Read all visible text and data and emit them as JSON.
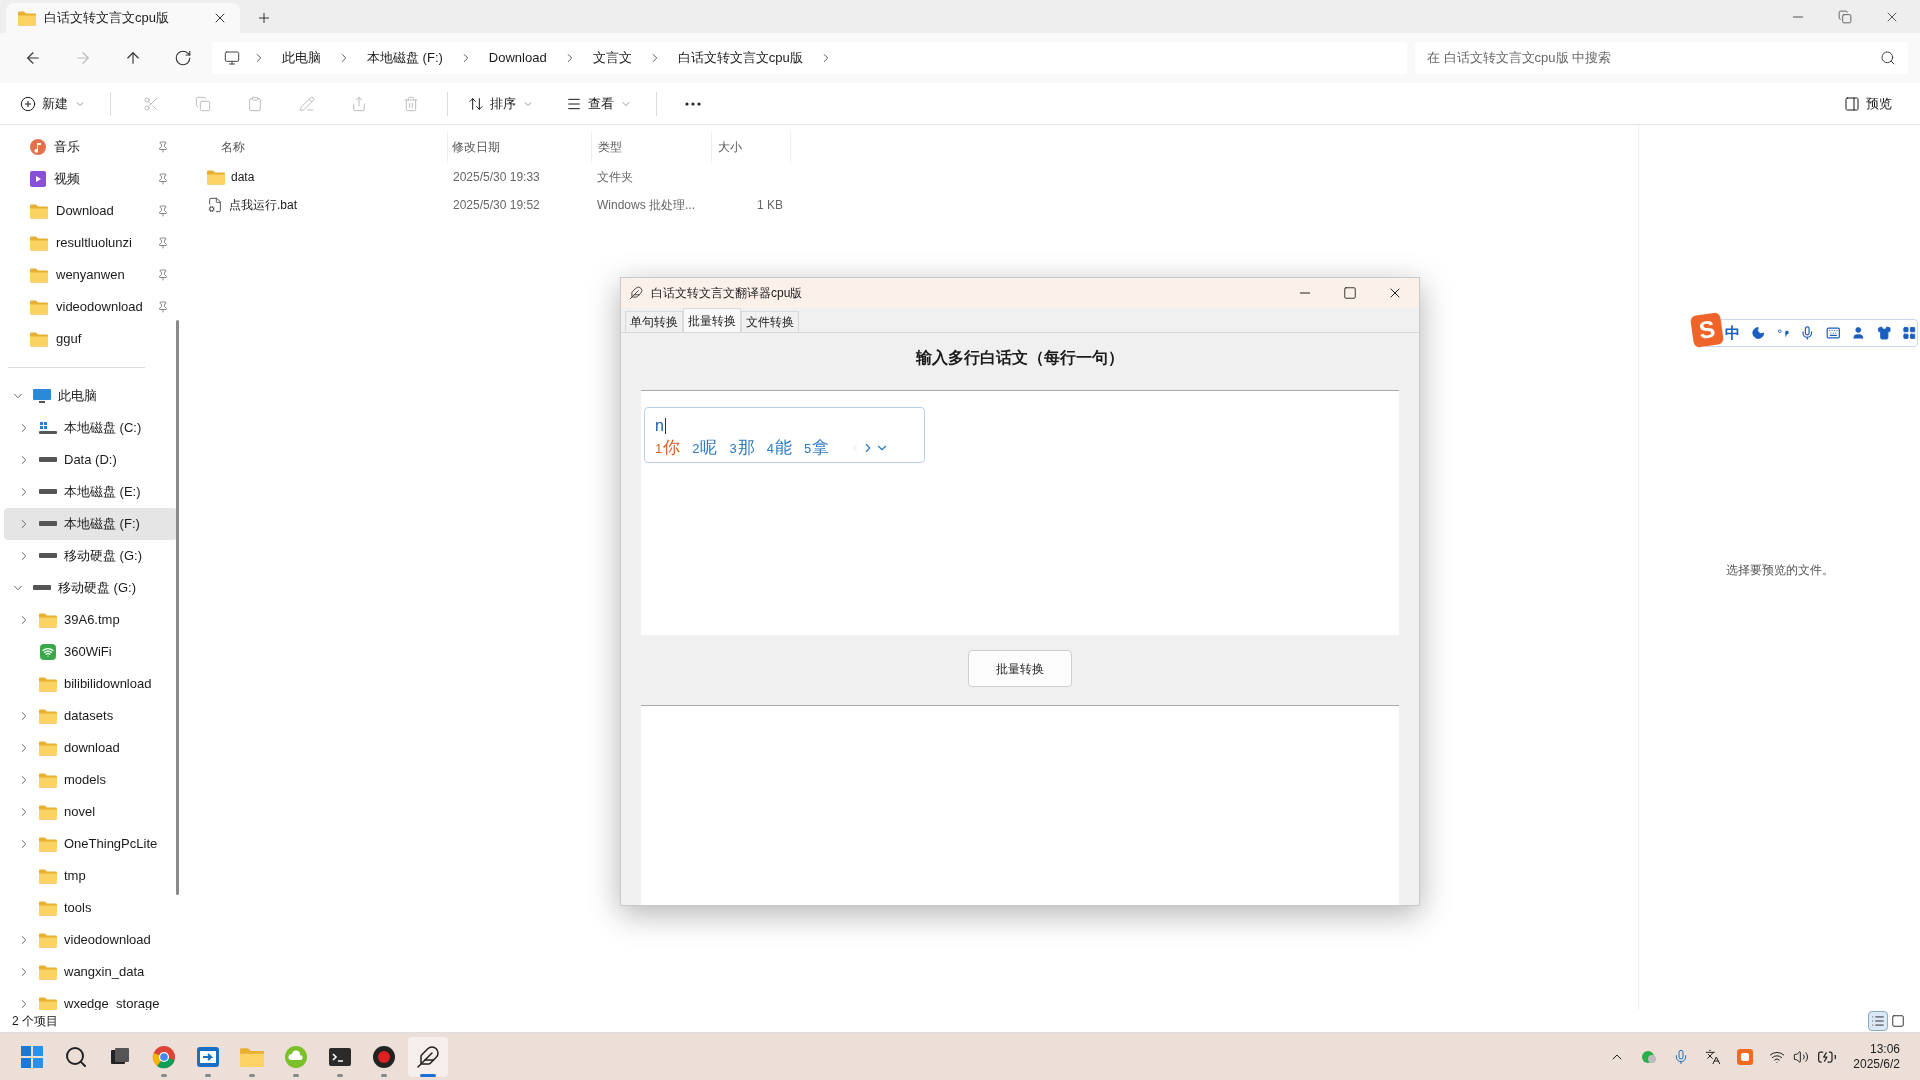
{
  "explorer": {
    "tab_title": "白话文转文言文cpu版"
  },
  "breadcrumb": [
    "此电脑",
    "本地磁盘 (F:)",
    "Download",
    "文言文",
    "白话文转文言文cpu版"
  ],
  "search": {
    "placeholder": "在 白话文转文言文cpu版 中搜索"
  },
  "toolbar": {
    "new": "新建",
    "actions": [
      {
        "kind": "cut",
        "disabled": true
      },
      {
        "kind": "copy",
        "disabled": true
      },
      {
        "kind": "paste",
        "disabled": true
      },
      {
        "kind": "rename",
        "disabled": true
      },
      {
        "kind": "share",
        "disabled": true
      },
      {
        "kind": "delete",
        "disabled": true
      }
    ],
    "sort": "排序",
    "view": "查看",
    "preview": "预览"
  },
  "quick_access": [
    {
      "name": "音乐",
      "kind": "music",
      "pinned": true
    },
    {
      "name": "视频",
      "kind": "video",
      "pinned": true
    },
    {
      "name": "Download",
      "kind": "folder",
      "pinned": true
    },
    {
      "name": "resultluolunzi",
      "kind": "folder",
      "pinned": true
    },
    {
      "name": "wenyanwen",
      "kind": "folder",
      "pinned": true
    },
    {
      "name": "videodownload",
      "kind": "folder",
      "pinned": true
    },
    {
      "name": "gguf",
      "kind": "folder",
      "pinned": false
    }
  ],
  "tree": [
    {
      "name": "此电脑",
      "kind": "pc",
      "expandable": true,
      "expanded": true,
      "selected": false,
      "children": [
        {
          "name": "本地磁盘 (C:)",
          "kind": "os_drive",
          "expandable": true,
          "expanded": false,
          "selected": false
        },
        {
          "name": "Data (D:)",
          "kind": "drive",
          "expandable": true,
          "expanded": false,
          "selected": false
        },
        {
          "name": "本地磁盘 (E:)",
          "kind": "drive",
          "expandable": true,
          "expanded": false,
          "selected": false
        },
        {
          "name": "本地磁盘 (F:)",
          "kind": "drive",
          "expandable": true,
          "expanded": false,
          "selected": true
        },
        {
          "name": "移动硬盘 (G:)",
          "kind": "drive",
          "expandable": true,
          "expanded": false,
          "selected": false
        }
      ]
    },
    {
      "name": "移动硬盘 (G:)",
      "kind": "drive",
      "expandable": true,
      "expanded": true,
      "selected": false,
      "children": [
        {
          "name": "39A6.tmp",
          "kind": "folder",
          "expandable": true,
          "expanded": false,
          "selected": false
        },
        {
          "name": "360WiFi",
          "kind": "wifi_app",
          "expandable": false,
          "expanded": false,
          "selected": false
        },
        {
          "name": "bilibilidownload",
          "kind": "folder",
          "expandable": false,
          "expanded": false,
          "selected": false
        },
        {
          "name": "datasets",
          "kind": "folder",
          "expandable": true,
          "expanded": false,
          "selected": false
        },
        {
          "name": "download",
          "kind": "folder",
          "expandable": true,
          "expanded": false,
          "selected": false
        },
        {
          "name": "models",
          "kind": "folder",
          "expandable": true,
          "expanded": false,
          "selected": false
        },
        {
          "name": "novel",
          "kind": "folder",
          "expandable": true,
          "expanded": false,
          "selected": false
        },
        {
          "name": "OneThingPcLite",
          "kind": "folder",
          "expandable": true,
          "expanded": false,
          "selected": false
        },
        {
          "name": "tmp",
          "kind": "folder",
          "expandable": false,
          "expanded": false,
          "selected": false
        },
        {
          "name": "tools",
          "kind": "folder",
          "expandable": false,
          "expanded": false,
          "selected": false
        },
        {
          "name": "videodownload",
          "kind": "folder",
          "expandable": true,
          "expanded": false,
          "selected": false
        },
        {
          "name": "wangxin_data",
          "kind": "folder",
          "expandable": true,
          "expanded": false,
          "selected": false
        },
        {
          "name": "wxedge_storage",
          "kind": "folder",
          "expandable": true,
          "expanded": false,
          "selected": false
        }
      ]
    }
  ],
  "files": {
    "columns": [
      "名称",
      "修改日期",
      "类型",
      "大小"
    ],
    "rows": [
      {
        "kind": "folder",
        "name": "data",
        "date": "2025/5/30 19:33",
        "type": "文件夹"
      },
      {
        "kind": "batch",
        "name": "点我运行.bat",
        "date": "2025/5/30 19:52",
        "type": "Windows 批处理...",
        "size": "1 KB"
      }
    ]
  },
  "preview_pane": {
    "message": "选择要预览的文件。"
  },
  "status_bar": {
    "count": "2 个项目",
    "views": [
      {
        "kind": "details",
        "selected": true
      },
      {
        "kind": "tiles",
        "selected": false
      }
    ]
  },
  "app_window": {
    "title": "白话文转文言文翻译器cpu版",
    "tabs": [
      {
        "label": "单句转换",
        "selected": false
      },
      {
        "label": "批量转换",
        "selected": true
      },
      {
        "label": "文件转换",
        "selected": false
      }
    ],
    "heading": "输入多行白话文（每行一句）",
    "button": "批量转换"
  },
  "ime_candidates": {
    "composition": "n",
    "candidates": [
      {
        "index": "1",
        "text": "你",
        "selected": true
      },
      {
        "index": "2",
        "text": "呢",
        "selected": false
      },
      {
        "index": "3",
        "text": "那",
        "selected": false
      },
      {
        "index": "4",
        "text": "能",
        "selected": false
      },
      {
        "index": "5",
        "text": "拿",
        "selected": false
      }
    ]
  },
  "ime_toolbar": {
    "logo": "S",
    "mode": "中"
  },
  "taskbar": {
    "apps": [
      {
        "kind": "start",
        "running": false,
        "active": false
      },
      {
        "kind": "search",
        "running": false,
        "active": false
      },
      {
        "kind": "taskview",
        "running": false,
        "active": false
      },
      {
        "kind": "chrome",
        "running": true,
        "active": false
      },
      {
        "kind": "remote",
        "running": true,
        "active": false
      },
      {
        "kind": "explorer",
        "running": true,
        "active": false
      },
      {
        "kind": "cloud",
        "running": true,
        "active": false
      },
      {
        "kind": "terminal",
        "running": true,
        "active": false
      },
      {
        "kind": "recorder",
        "running": true,
        "active": false
      },
      {
        "kind": "feather",
        "running": true,
        "active": true
      }
    ],
    "time": "13:06",
    "date": "2025/6/2"
  }
}
